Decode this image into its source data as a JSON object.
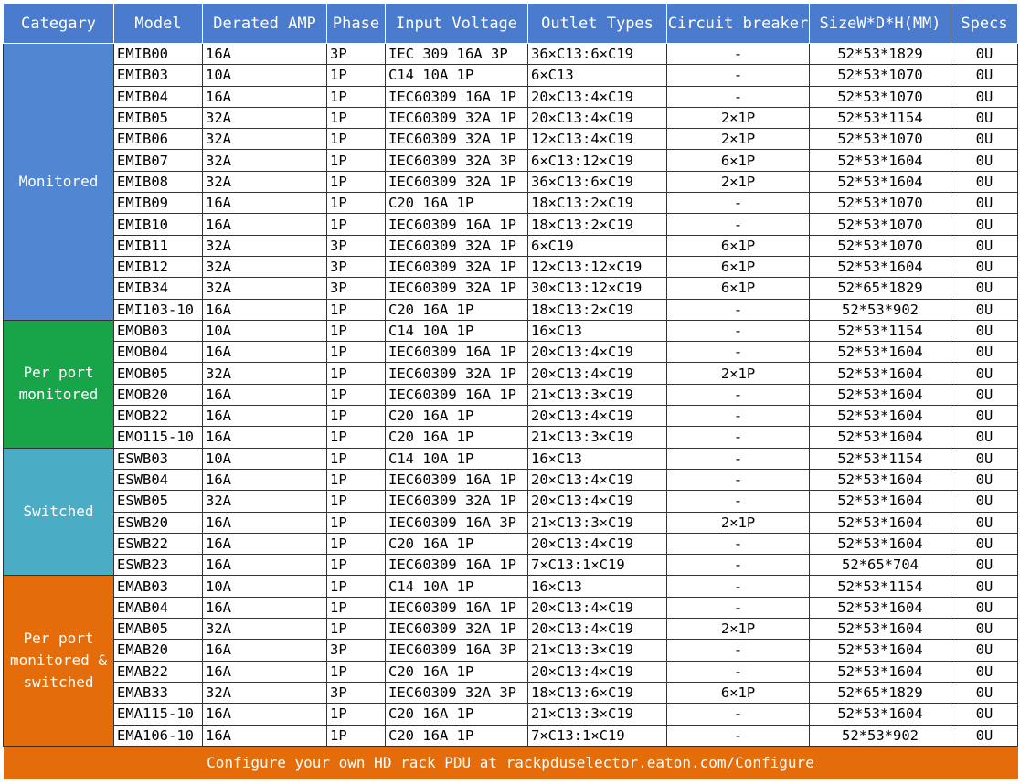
{
  "headers": [
    "Categary",
    "Model",
    "Derated AMP",
    "Phase",
    "Input Voltage",
    "Outlet Types",
    "Circuit breaker",
    "SizeW*D*H(MM)",
    "Specs"
  ],
  "groups": [
    {
      "category": "Monitored",
      "color": "#5186d3",
      "rows": [
        [
          "EMIB00",
          "16A",
          "3P",
          "IEC 309 16A 3P",
          "36×C13:6×C19",
          "-",
          "52*53*1829",
          "0U"
        ],
        [
          "EMIB03",
          "10A",
          "1P",
          "C14 10A 1P",
          "6×C13",
          "-",
          "52*53*1070",
          "0U"
        ],
        [
          "EMIB04",
          "16A",
          "1P",
          "IEC60309 16A 1P",
          "20×C13:4×C19",
          "-",
          "52*53*1070",
          "0U"
        ],
        [
          "EMIB05",
          "32A",
          "1P",
          "IEC60309 32A 1P",
          "20×C13:4×C19",
          "2×1P",
          "52*53*1154",
          "0U"
        ],
        [
          "EMIB06",
          "32A",
          "1P",
          "IEC60309 32A 1P",
          "12×C13:4×C19",
          "2×1P",
          "52*53*1070",
          "0U"
        ],
        [
          "EMIB07",
          "32A",
          "1P",
          "IEC60309 32A 3P",
          "6×C13:12×C19",
          "6×1P",
          "52*53*1604",
          "0U"
        ],
        [
          "EMIB08",
          "32A",
          "1P",
          "IEC60309 32A 1P",
          "36×C13:6×C19",
          "2×1P",
          "52*53*1604",
          "0U"
        ],
        [
          "EMIB09",
          "16A",
          "1P",
          "C20 16A 1P",
          "18×C13:2×C19",
          "-",
          "52*53*1070",
          "0U"
        ],
        [
          "EMIB10",
          "16A",
          "1P",
          "IEC60309 16A 1P",
          "18×C13:2×C19",
          "-",
          "52*53*1070",
          "0U"
        ],
        [
          "EMIB11",
          "32A",
          "3P",
          "IEC60309 32A 1P",
          "6×C19",
          "6×1P",
          "52*53*1070",
          "0U"
        ],
        [
          "EMIB12",
          "32A",
          "3P",
          "IEC60309 32A 1P",
          "12×C13:12×C19",
          "6×1P",
          "52*53*1604",
          "0U"
        ],
        [
          "EMIB34",
          "32A",
          "3P",
          "IEC60309 32A 1P",
          "30×C13:12×C19",
          "6×1P",
          "52*65*1829",
          "0U"
        ],
        [
          "EMI103-10",
          "16A",
          "1P",
          "C20 16A 1P",
          "18×C13:2×C19",
          "-",
          "52*53*902",
          "0U"
        ]
      ]
    },
    {
      "category": "Per port monitored",
      "color": "#18a54a",
      "rows": [
        [
          "EMOB03",
          "10A",
          "1P",
          "C14 10A 1P",
          "16×C13",
          "-",
          "52*53*1154",
          "0U"
        ],
        [
          "EMOB04",
          "16A",
          "1P",
          "IEC60309 16A 1P",
          "20×C13:4×C19",
          "-",
          "52*53*1604",
          "0U"
        ],
        [
          "EMOB05",
          "32A",
          "1P",
          "IEC60309 32A 1P",
          "20×C13:4×C19",
          "2×1P",
          "52*53*1604",
          "0U"
        ],
        [
          "EMOB20",
          "16A",
          "1P",
          "IEC60309 16A 1P",
          "21×C13:3×C19",
          "-",
          "52*53*1604",
          "0U"
        ],
        [
          "EMOB22",
          "16A",
          "1P",
          "C20 16A 1P",
          "20×C13:4×C19",
          "-",
          "52*53*1604",
          "0U"
        ],
        [
          "EMO115-10",
          "16A",
          "1P",
          "C20 16A 1P",
          "21×C13:3×C19",
          "-",
          "52*53*1604",
          "0U"
        ]
      ]
    },
    {
      "category": "Switched",
      "color": "#4bacc6",
      "rows": [
        [
          "ESWB03",
          "10A",
          "1P",
          "C14 10A 1P",
          "16×C13",
          "-",
          "52*53*1154",
          "0U"
        ],
        [
          "ESWB04",
          "16A",
          "1P",
          "IEC60309 16A 1P",
          "20×C13:4×C19",
          "-",
          "52*53*1604",
          "0U"
        ],
        [
          "ESWB05",
          "32A",
          "1P",
          "IEC60309 32A 1P",
          "20×C13:4×C19",
          "-",
          "52*53*1604",
          "0U"
        ],
        [
          "ESWB20",
          "16A",
          "1P",
          "IEC60309 16A 3P",
          "21×C13:3×C19",
          "2×1P",
          "52*53*1604",
          "0U"
        ],
        [
          "ESWB22",
          "16A",
          "1P",
          "C20 16A 1P",
          "20×C13:4×C19",
          "-",
          "52*53*1604",
          "0U"
        ],
        [
          "ESWB23",
          "16A",
          "1P",
          "IEC60309 16A 1P",
          "7×C13:1×C19",
          "-",
          "52*65*704",
          "0U"
        ]
      ]
    },
    {
      "category": "Per port monitored & switched",
      "color": "#e46c0a",
      "rows": [
        [
          "EMAB03",
          "10A",
          "1P",
          "C14 10A 1P",
          "16×C13",
          "-",
          "52*53*1154",
          "0U"
        ],
        [
          "EMAB04",
          "16A",
          "1P",
          "IEC60309 16A 1P",
          "20×C13:4×C19",
          "-",
          "52*53*1604",
          "0U"
        ],
        [
          "EMAB05",
          "32A",
          "1P",
          "IEC60309 32A 1P",
          "20×C13:4×C19",
          "2×1P",
          "52*53*1604",
          "0U"
        ],
        [
          "EMAB20",
          "16A",
          "3P",
          "IEC60309 16A 3P",
          "21×C13:3×C19",
          "-",
          "52*53*1604",
          "0U"
        ],
        [
          "EMAB22",
          "16A",
          "1P",
          "C20 16A 1P",
          "20×C13:4×C19",
          "-",
          "52*53*1604",
          "0U"
        ],
        [
          "EMAB33",
          "32A",
          "3P",
          "IEC60309 32A 3P",
          "18×C13:6×C19",
          "6×1P",
          "52*65*1829",
          "0U"
        ],
        [
          "EMA115-10",
          "16A",
          "1P",
          "C20 16A 1P",
          "21×C13:3×C19",
          "-",
          "52*53*1604",
          "0U"
        ],
        [
          "EMA106-10",
          "16A",
          "1P",
          "C20 16A 1P",
          "7×C13:1×C19",
          "-",
          "52*53*902",
          "0U"
        ]
      ]
    }
  ],
  "footer": "Configure your own HD rack PDU at rackpduselector.eaton.com/Configure"
}
